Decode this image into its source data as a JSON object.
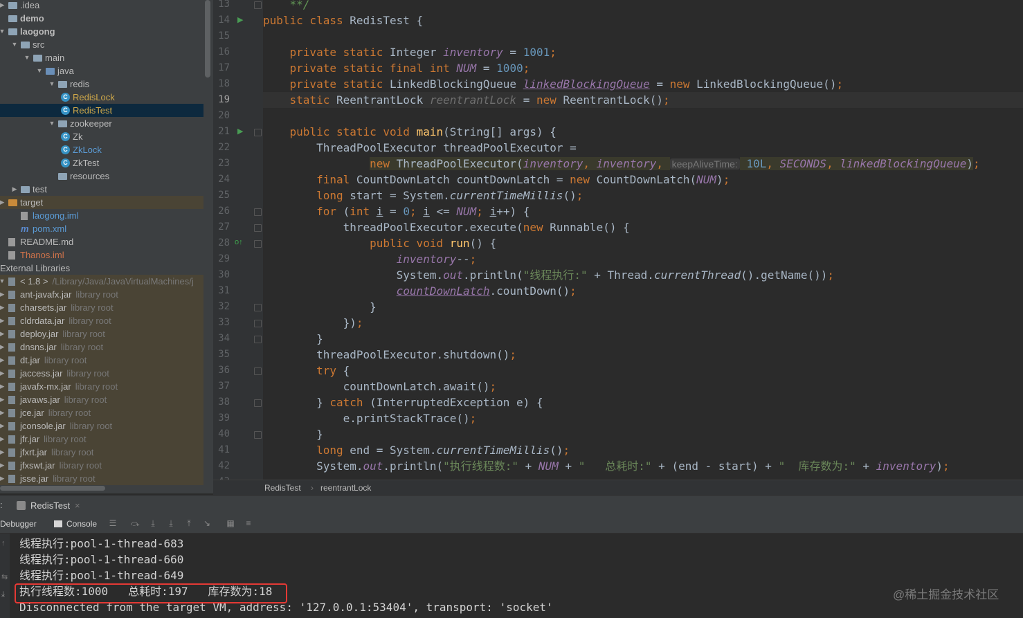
{
  "project_tree": [
    {
      "label": ".idea",
      "depth": 0,
      "icon": "folder-icon",
      "arrow": "right"
    },
    {
      "label": "demo",
      "depth": 0,
      "icon": "module-folder-icon",
      "arrow": "none",
      "bold": true
    },
    {
      "label": "laogong",
      "depth": 0,
      "icon": "module-folder-icon",
      "arrow": "down",
      "bold": true
    },
    {
      "label": "src",
      "depth": 1,
      "icon": "folder-icon",
      "arrow": "down"
    },
    {
      "label": "main",
      "depth": 2,
      "icon": "folder-icon",
      "arrow": "down"
    },
    {
      "label": "java",
      "depth": 3,
      "icon": "source-folder-icon",
      "arrow": "down"
    },
    {
      "label": "redis",
      "depth": 4,
      "icon": "package-icon",
      "arrow": "down"
    },
    {
      "label": "RedisLock",
      "depth": 5,
      "icon": "class-icon",
      "color": "#d0a94a"
    },
    {
      "label": "RedisTest",
      "depth": 5,
      "icon": "class-icon",
      "color": "#d0a94a",
      "selected": true
    },
    {
      "label": "zookeeper",
      "depth": 4,
      "icon": "package-icon",
      "arrow": "down"
    },
    {
      "label": "Zk",
      "depth": 5,
      "icon": "class-icon"
    },
    {
      "label": "ZkLock",
      "depth": 5,
      "icon": "class-icon",
      "color": "#5b9bd5"
    },
    {
      "label": "ZkTest",
      "depth": 5,
      "icon": "class-icon"
    },
    {
      "label": "resources",
      "depth": 4,
      "icon": "resources-folder-icon"
    },
    {
      "label": "test",
      "depth": 1,
      "icon": "folder-icon",
      "arrow": "right"
    },
    {
      "label": "target",
      "depth": 0,
      "icon": "excluded-folder-icon",
      "arrow": "right",
      "highlight": true
    },
    {
      "label": "laogong.iml",
      "depth": 1,
      "icon": "iml-file-icon",
      "color": "#5b9bd5"
    },
    {
      "label": "pom.xml",
      "depth": 1,
      "icon": "maven-icon",
      "color": "#5b9bd5"
    },
    {
      "label": "README.md",
      "depth": 0,
      "icon": "markdown-file-icon"
    },
    {
      "label": "Thanos.iml",
      "depth": 0,
      "icon": "iml-file-icon",
      "color": "#d0734a"
    },
    {
      "label": "External Libraries",
      "depth": -1,
      "icon": "none"
    },
    {
      "label": "< 1.8 >",
      "sub": "/Library/Java/JavaVirtualMachines/j",
      "depth": 0,
      "icon": "jdk-icon",
      "arrow": "down",
      "highlight": true
    },
    {
      "label": "ant-javafx.jar",
      "sub": "library root",
      "depth": 0,
      "icon": "jar-icon",
      "arrow": "right",
      "highlight": true
    },
    {
      "label": "charsets.jar",
      "sub": "library root",
      "depth": 0,
      "icon": "jar-icon",
      "arrow": "right",
      "highlight": true
    },
    {
      "label": "cldrdata.jar",
      "sub": "library root",
      "depth": 0,
      "icon": "jar-icon",
      "arrow": "right",
      "highlight": true
    },
    {
      "label": "deploy.jar",
      "sub": "library root",
      "depth": 0,
      "icon": "jar-icon",
      "arrow": "right",
      "highlight": true
    },
    {
      "label": "dnsns.jar",
      "sub": "library root",
      "depth": 0,
      "icon": "jar-icon",
      "arrow": "right",
      "highlight": true
    },
    {
      "label": "dt.jar",
      "sub": "library root",
      "depth": 0,
      "icon": "jar-icon",
      "arrow": "right",
      "highlight": true
    },
    {
      "label": "jaccess.jar",
      "sub": "library root",
      "depth": 0,
      "icon": "jar-icon",
      "arrow": "right",
      "highlight": true
    },
    {
      "label": "javafx-mx.jar",
      "sub": "library root",
      "depth": 0,
      "icon": "jar-icon",
      "arrow": "right",
      "highlight": true
    },
    {
      "label": "javaws.jar",
      "sub": "library root",
      "depth": 0,
      "icon": "jar-icon",
      "arrow": "right",
      "highlight": true
    },
    {
      "label": "jce.jar",
      "sub": "library root",
      "depth": 0,
      "icon": "jar-icon",
      "arrow": "right",
      "highlight": true
    },
    {
      "label": "jconsole.jar",
      "sub": "library root",
      "depth": 0,
      "icon": "jar-icon",
      "arrow": "right",
      "highlight": true
    },
    {
      "label": "jfr.jar",
      "sub": "library root",
      "depth": 0,
      "icon": "jar-icon",
      "arrow": "right",
      "highlight": true
    },
    {
      "label": "jfxrt.jar",
      "sub": "library root",
      "depth": 0,
      "icon": "jar-icon",
      "arrow": "right",
      "highlight": true
    },
    {
      "label": "jfxswt.jar",
      "sub": "library root",
      "depth": 0,
      "icon": "jar-icon",
      "arrow": "right",
      "highlight": true
    },
    {
      "label": "jsse.jar",
      "sub": "library root",
      "depth": 0,
      "icon": "jar-icon",
      "arrow": "right",
      "highlight": true
    }
  ],
  "editor": {
    "line_numbers": [
      "13",
      "14",
      "15",
      "16",
      "17",
      "18",
      "19",
      "20",
      "21",
      "22",
      "23",
      "24",
      "25",
      "26",
      "27",
      "28",
      "29",
      "30",
      "31",
      "32",
      "33",
      "34",
      "35",
      "36",
      "37",
      "38",
      "39",
      "40",
      "41",
      "42",
      "43"
    ],
    "current_line": "19",
    "code": [
      [
        [
          "    **/",
          "cmt"
        ]
      ],
      [
        [
          "public class ",
          "kw"
        ],
        [
          "RedisTest {",
          ""
        ]
      ],
      [],
      [
        [
          "    private static ",
          "kw"
        ],
        [
          "Integer ",
          ""
        ],
        [
          "inventory",
          "fld"
        ],
        [
          " = ",
          ""
        ],
        [
          "1001",
          "num"
        ],
        [
          ";",
          "kw"
        ]
      ],
      [
        [
          "    private static final int ",
          "kw"
        ],
        [
          "NUM",
          "fld"
        ],
        [
          " = ",
          ""
        ],
        [
          "1000",
          "num"
        ],
        [
          ";",
          "kw"
        ]
      ],
      [
        [
          "    private static ",
          "kw"
        ],
        [
          "LinkedBlockingQueue ",
          ""
        ],
        [
          "linkedBlockingQueue",
          "fld und"
        ],
        [
          " = ",
          ""
        ],
        [
          "new ",
          "kw"
        ],
        [
          "LinkedBlockingQueue()",
          ""
        ],
        [
          ";",
          "kw"
        ]
      ],
      [
        [
          "    static ",
          "kw"
        ],
        [
          "ReentrantLock ",
          ""
        ],
        [
          "reentrantLock",
          "fld gray"
        ],
        [
          " = ",
          ""
        ],
        [
          "new ",
          "kw"
        ],
        [
          "ReentrantLock()",
          ""
        ],
        [
          ";",
          "kw"
        ]
      ],
      [],
      [
        [
          "    public static void ",
          "kw"
        ],
        [
          "main",
          "mth"
        ],
        [
          "(String[] args) {",
          ""
        ]
      ],
      [
        [
          "        ThreadPoolExecutor threadPoolExecutor =",
          ""
        ]
      ],
      [
        [
          "                ",
          ""
        ],
        [
          "new ",
          "kw warnbg"
        ],
        [
          "ThreadPoolExecutor(",
          "warnbg"
        ],
        [
          "inventory",
          "fld warnbg"
        ],
        [
          ", ",
          "kw warnbg"
        ],
        [
          "inventory",
          "fld warnbg"
        ],
        [
          ", ",
          "kw warnbg"
        ],
        [
          "keepAliveTime:",
          "hint"
        ],
        [
          " ",
          "warnbg"
        ],
        [
          "10L",
          "num warnbg"
        ],
        [
          ", ",
          "kw warnbg"
        ],
        [
          "SECONDS",
          "fld warnbg"
        ],
        [
          ", ",
          "kw warnbg"
        ],
        [
          "linkedBlockingQueue",
          "fld warnbg"
        ],
        [
          ")",
          "warnbg"
        ],
        [
          ";",
          "kw"
        ]
      ],
      [
        [
          "        final ",
          "kw"
        ],
        [
          "CountDownLatch countDownLatch = ",
          ""
        ],
        [
          "new ",
          "kw"
        ],
        [
          "CountDownLatch(",
          ""
        ],
        [
          "NUM",
          "fld"
        ],
        [
          ")",
          ""
        ],
        [
          ";",
          "kw"
        ]
      ],
      [
        [
          "        long ",
          "kw"
        ],
        [
          "start = System.",
          ""
        ],
        [
          "currentTimeMillis",
          "itl"
        ],
        [
          "()",
          ""
        ],
        [
          ";",
          "kw"
        ]
      ],
      [
        [
          "        for ",
          "kw"
        ],
        [
          "(",
          ""
        ],
        [
          "int ",
          "kw"
        ],
        [
          "i",
          "und"
        ],
        [
          " = ",
          ""
        ],
        [
          "0",
          "num"
        ],
        [
          "; ",
          "kw"
        ],
        [
          "i",
          "und"
        ],
        [
          " <= ",
          ""
        ],
        [
          "NUM",
          "fld"
        ],
        [
          "; ",
          "kw"
        ],
        [
          "i",
          "und"
        ],
        [
          "++) {",
          ""
        ]
      ],
      [
        [
          "            threadPoolExecutor.execute(",
          ""
        ],
        [
          "new ",
          "kw"
        ],
        [
          "Runnable() {",
          ""
        ]
      ],
      [
        [
          "                public void ",
          "kw"
        ],
        [
          "run",
          "mth"
        ],
        [
          "() {",
          ""
        ]
      ],
      [
        [
          "                    ",
          ""
        ],
        [
          "inventory",
          "fld"
        ],
        [
          "--",
          ""
        ],
        [
          ";",
          "kw"
        ]
      ],
      [
        [
          "                    System.",
          ""
        ],
        [
          "out",
          "fld"
        ],
        [
          ".println(",
          ""
        ],
        [
          "\"线程执行:\"",
          "str"
        ],
        [
          " + Thread.",
          ""
        ],
        [
          "currentThread",
          "itl"
        ],
        [
          "().getName())",
          ""
        ],
        [
          ";",
          "kw"
        ]
      ],
      [
        [
          "                    ",
          ""
        ],
        [
          "countDownLatch",
          "fld und"
        ],
        [
          ".countDown()",
          ""
        ],
        [
          ";",
          "kw"
        ]
      ],
      [
        [
          "                }",
          ""
        ]
      ],
      [
        [
          "            })",
          ""
        ],
        [
          ";",
          "kw"
        ]
      ],
      [
        [
          "        }",
          ""
        ]
      ],
      [
        [
          "        threadPoolExecutor.shutdown()",
          ""
        ],
        [
          ";",
          "kw"
        ]
      ],
      [
        [
          "        try ",
          "kw"
        ],
        [
          "{",
          ""
        ]
      ],
      [
        [
          "            countDownLatch.await()",
          ""
        ],
        [
          ";",
          "kw"
        ]
      ],
      [
        [
          "        } ",
          ""
        ],
        [
          "catch ",
          "kw"
        ],
        [
          "(InterruptedException e) {",
          ""
        ]
      ],
      [
        [
          "            e.printStackTrace()",
          ""
        ],
        [
          ";",
          "kw"
        ]
      ],
      [
        [
          "        }",
          ""
        ]
      ],
      [
        [
          "        long ",
          "kw"
        ],
        [
          "end = System.",
          ""
        ],
        [
          "currentTimeMillis",
          "itl"
        ],
        [
          "()",
          ""
        ],
        [
          ";",
          "kw"
        ]
      ],
      [
        [
          "        System.",
          ""
        ],
        [
          "out",
          "fld"
        ],
        [
          ".println(",
          ""
        ],
        [
          "\"执行线程数:\"",
          "str"
        ],
        [
          " + ",
          ""
        ],
        [
          "NUM",
          "fld"
        ],
        [
          " + ",
          ""
        ],
        [
          "\"   总耗时:\"",
          "str"
        ],
        [
          " + (end - start) + ",
          ""
        ],
        [
          "\"  库存数为:\"",
          "str"
        ],
        [
          " + ",
          ""
        ],
        [
          "inventory",
          "fld"
        ],
        [
          ")",
          ""
        ],
        [
          ";",
          "kw"
        ]
      ],
      []
    ]
  },
  "breadcrumb": {
    "items": [
      "RedisTest",
      "reentrantLock"
    ],
    "separator": "›"
  },
  "run_panel": {
    "left_label": ":",
    "tab": "RedisTest",
    "tab_close": "×",
    "toolbar": {
      "debugger": "Debugger",
      "console": "Console"
    },
    "console_lines": [
      "线程执行:pool-1-thread-683",
      "线程执行:pool-1-thread-660",
      "线程执行:pool-1-thread-649",
      "执行线程数:1000   总耗时:197   库存数为:18",
      "Disconnected from the target VM, address: '127.0.0.1:53404', transport: 'socket'"
    ],
    "highlighted_line_index": 3
  },
  "watermark": "@稀土掘金技术社区",
  "colors": {
    "accent_red": "#e53935",
    "selection": "#0d293e",
    "keyword": "#cc7832",
    "field": "#9876aa"
  }
}
